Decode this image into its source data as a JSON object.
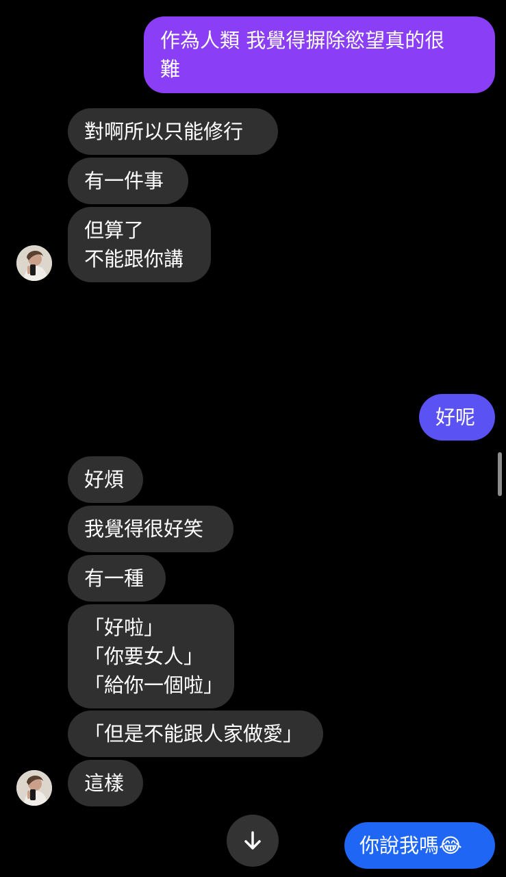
{
  "messages": {
    "sent1": "作為人類 我覺得摒除慾望真的很\n難",
    "recv1": "對啊所以只能修行",
    "recv2": "有一件事",
    "recv3": "但算了\n不能跟你講",
    "sent_emoji": "😂",
    "sent2": "好呢",
    "recv4": "好煩",
    "recv5": "我覺得很好笑",
    "recv6": "有一種",
    "recv7": "「好啦」\n「你要女人」\n「給你一個啦」",
    "recv8": "「但是不能跟人家做愛」",
    "recv9": "這樣",
    "sent3": "你說我嗎😂"
  },
  "icons": {
    "scroll_down": "arrow-down-icon",
    "avatar": "contact-avatar"
  },
  "colors": {
    "background": "#000000",
    "received_bubble": "#303030",
    "sent_top": "#8a3ef5",
    "sent_middle": "#5a52f2",
    "sent_bottom": "#1f66f5",
    "text": "#ffffff"
  }
}
